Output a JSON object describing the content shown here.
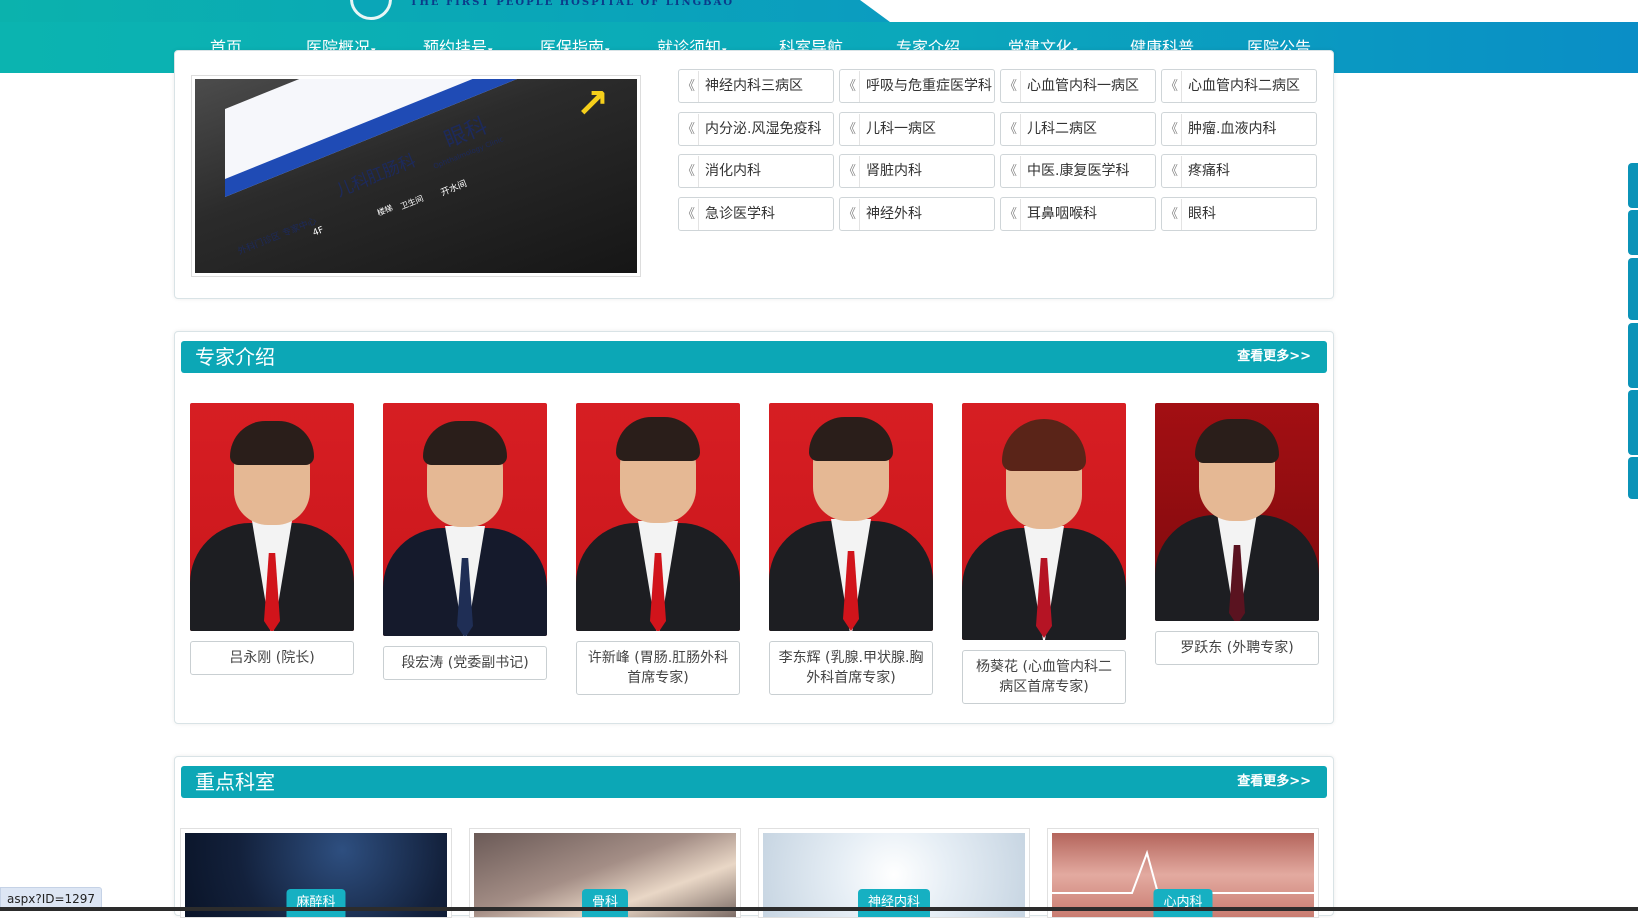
{
  "header": {
    "hospital_en": "THE FIRST PEOPLE HOSPITAL OF LINGBAO"
  },
  "nav": {
    "items": [
      {
        "label": "首页",
        "dropdown": false
      },
      {
        "label": "医院概况",
        "dropdown": true
      },
      {
        "label": "预约挂号",
        "dropdown": true
      },
      {
        "label": "医保指南",
        "dropdown": true
      },
      {
        "label": "就诊须知",
        "dropdown": true
      },
      {
        "label": "科室导航",
        "dropdown": false
      },
      {
        "label": "专家介绍",
        "dropdown": false
      },
      {
        "label": "党建文化",
        "dropdown": true
      },
      {
        "label": "健康科普",
        "dropdown": false
      },
      {
        "label": "医院公告",
        "dropdown": false
      }
    ],
    "caret": "▾"
  },
  "signage": {
    "ophthalmology": "眼科",
    "ophthalmology_en": "Ophthalmology Clinic",
    "pediatrics": "儿科",
    "anorectal": "肛肠科",
    "left_area": "外科门诊区 专家中心",
    "floor": "4F",
    "toilet": "卫生间",
    "stairs": "楼梯",
    "water": "开水间"
  },
  "departments": {
    "chevron": "《",
    "items": [
      "神经内科三病区",
      "呼吸与危重症医学科",
      "心血管内科一病区",
      "心血管内科二病区",
      "内分泌.风湿免疫科",
      "儿科一病区",
      "儿科二病区",
      "肿瘤.血液内科",
      "消化内科",
      "肾脏内科",
      "中医.康复医学科",
      "疼痛科",
      "急诊医学科",
      "神经外科",
      "耳鼻咽喉科",
      "眼科"
    ]
  },
  "experts_section": {
    "title": "专家介绍",
    "more": "查看更多>>",
    "experts": [
      {
        "name": "吕永刚 (院长)",
        "gender": "m"
      },
      {
        "name": "段宏涛 (党委副书记)",
        "gender": "m"
      },
      {
        "name": "许新峰 (胃肠.肛肠外科首席专家)",
        "gender": "m"
      },
      {
        "name": "李东辉 (乳腺.甲状腺.胸外科首席专家)",
        "gender": "m"
      },
      {
        "name": "杨葵花 (心血管内科二病区首席专家)",
        "gender": "f"
      },
      {
        "name": "罗跃东 (外聘专家)",
        "gender": "m"
      }
    ]
  },
  "key_depts_section": {
    "title": "重点科室",
    "more": "查看更多>>",
    "items": [
      {
        "label": "麻醉科"
      },
      {
        "label": "骨科"
      },
      {
        "label": "神经内科"
      },
      {
        "label": "心内科"
      }
    ]
  },
  "status_bar": {
    "url": "aspx?ID=1297"
  },
  "colors": {
    "nav_start": "#0bb4b0",
    "nav_end": "#0a8ec6",
    "section_header": "#0ca7b6",
    "portrait_red": "#d71e23"
  }
}
